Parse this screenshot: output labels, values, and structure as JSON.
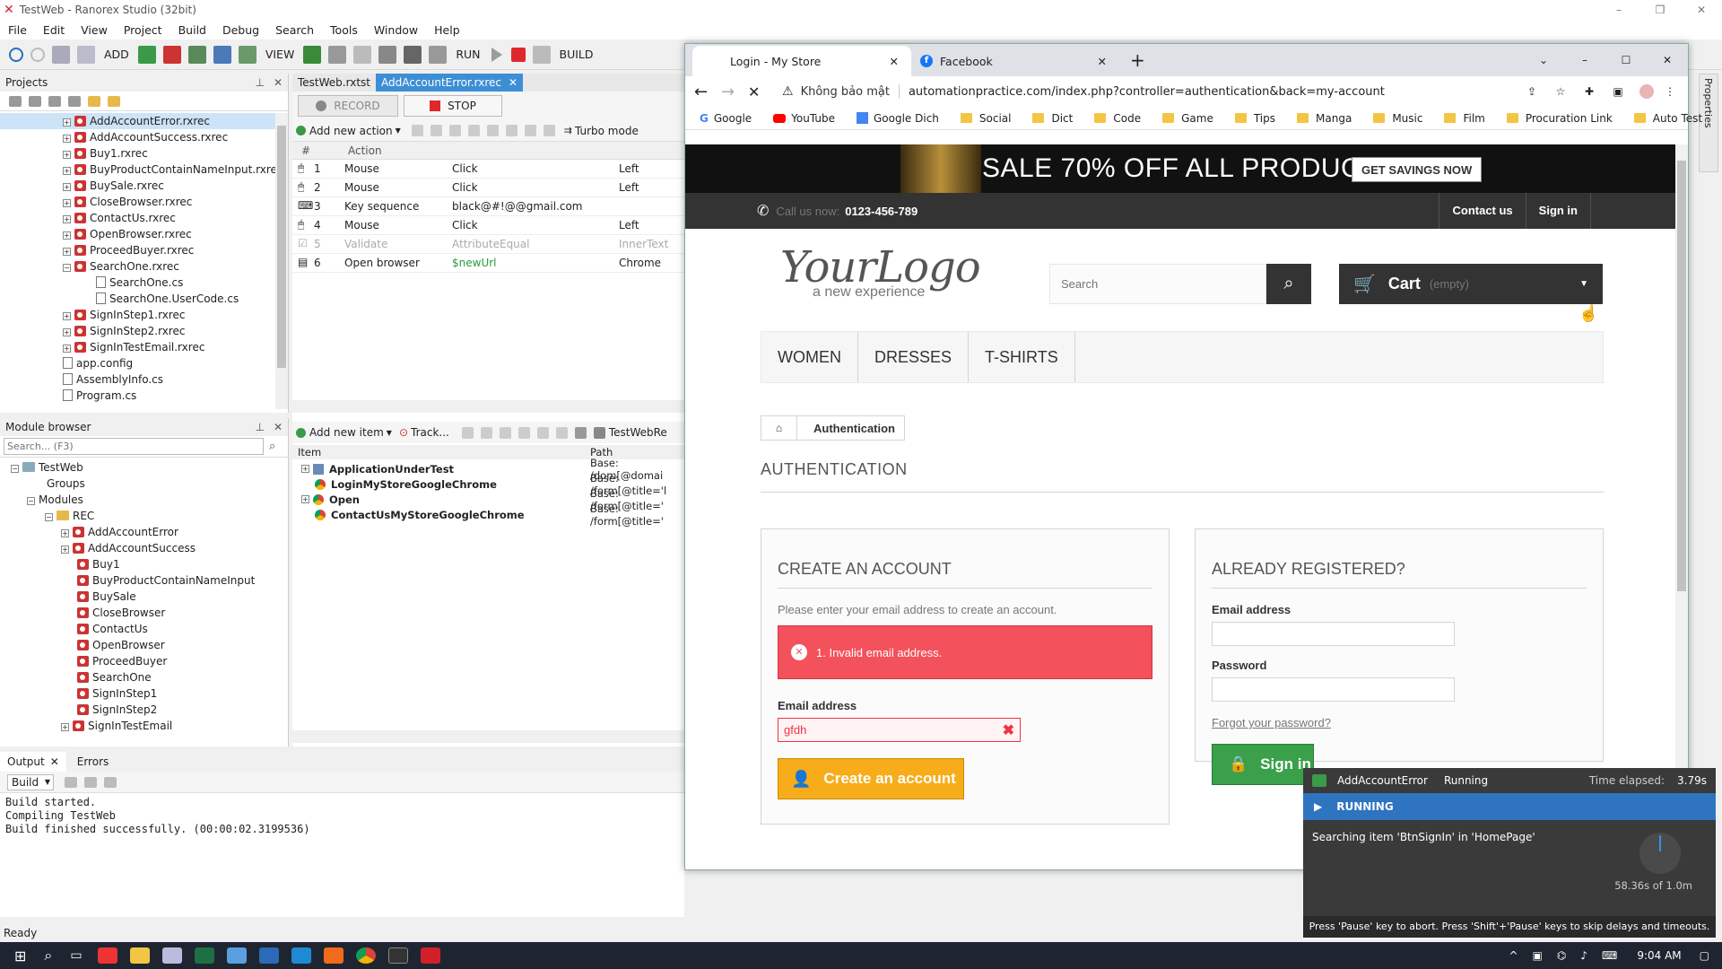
{
  "app": {
    "title": "TestWeb - Ranorex Studio (32bit)",
    "menu": [
      "File",
      "Edit",
      "View",
      "Project",
      "Build",
      "Debug",
      "Search",
      "Tools",
      "Window",
      "Help"
    ],
    "toolbar": {
      "add": "ADD",
      "view": "VIEW",
      "run": "RUN",
      "build": "BUILD"
    }
  },
  "projects": {
    "title": "Projects",
    "items": [
      {
        "label": "AddAccountError.rxrec",
        "selected": true
      },
      {
        "label": "AddAccountSuccess.rxrec"
      },
      {
        "label": "Buy1.rxrec"
      },
      {
        "label": "BuyProductContainNameInput.rxrec"
      },
      {
        "label": "BuySale.rxrec"
      },
      {
        "label": "CloseBrowser.rxrec"
      },
      {
        "label": "ContactUs.rxrec"
      },
      {
        "label": "OpenBrowser.rxrec"
      },
      {
        "label": "ProceedBuyer.rxrec"
      },
      {
        "label": "SearchOne.rxrec",
        "expanded": true
      },
      {
        "label": "SearchOne.cs",
        "child": true
      },
      {
        "label": "SearchOne.UserCode.cs",
        "child": true
      },
      {
        "label": "SignInStep1.rxrec"
      },
      {
        "label": "SignInStep2.rxrec"
      },
      {
        "label": "SignInTestEmail.rxrec"
      },
      {
        "label": "app.config",
        "plain": true
      },
      {
        "label": "AssemblyInfo.cs",
        "plain": true
      },
      {
        "label": "Program.cs",
        "plain": true
      }
    ]
  },
  "module_browser": {
    "title": "Module browser",
    "search_placeholder": "Search... (F3)",
    "root": "TestWeb",
    "groups": "Groups",
    "modules": "Modules",
    "folder": "REC",
    "items": [
      "AddAccountError",
      "AddAccountSuccess",
      "Buy1",
      "BuyProductContainNameInput",
      "BuySale",
      "CloseBrowser",
      "ContactUs",
      "OpenBrowser",
      "ProceedBuyer",
      "SearchOne",
      "SignInStep1",
      "SignInStep2",
      "SignInTestEmail"
    ]
  },
  "editor": {
    "tabs": [
      {
        "label": "TestWeb.rxtst"
      },
      {
        "label": "AddAccountError.rxrec",
        "active": true
      }
    ],
    "record": "RECORD",
    "stop": "STOP",
    "add_action": "Add new action",
    "turbo": "Turbo mode",
    "headers": [
      "#",
      "Action"
    ],
    "rows": [
      {
        "n": "1",
        "type": "Mouse",
        "action": "Click",
        "extra": "Left"
      },
      {
        "n": "2",
        "type": "Mouse",
        "action": "Click",
        "extra": "Left"
      },
      {
        "n": "3",
        "type": "Key sequence",
        "action": "black@#!@@gmail.com",
        "extra": ""
      },
      {
        "n": "4",
        "type": "Mouse",
        "action": "Click",
        "extra": "Left"
      },
      {
        "n": "5",
        "type": "Validate",
        "action": "AttributeEqual",
        "extra": "InnerText",
        "disabled": true
      },
      {
        "n": "6",
        "type": "Open browser",
        "action": "$newUrl",
        "extra": "Chrome",
        "var": true
      }
    ]
  },
  "repository": {
    "add_item": "Add new item",
    "track": "Track...",
    "repo_name": "TestWebRe",
    "headers": [
      "Item",
      "Path"
    ],
    "rows": [
      {
        "item": "ApplicationUnderTest",
        "path": "Base: /dom[@domai"
      },
      {
        "item": "LoginMyStoreGoogleChrome",
        "path": "Base: /form[@title='l"
      },
      {
        "item": "Open",
        "path": "Base: /form[@title='"
      },
      {
        "item": "ContactUsMyStoreGoogleChrome",
        "path": "Base: /form[@title='"
      }
    ]
  },
  "output": {
    "tabs": [
      "Output",
      "Errors"
    ],
    "select": "Build",
    "lines": [
      "Build started.",
      "Compiling TestWeb",
      "Build finished successfully. (00:00:02.3199536)"
    ]
  },
  "status": "Ready",
  "browser": {
    "tabs": [
      {
        "label": "Login - My Store",
        "active": true
      },
      {
        "label": "Facebook"
      }
    ],
    "security": "Không bảo mật",
    "url": "automationpractice.com/index.php?controller=authentication&back=my-account",
    "bookmarks": [
      "Google",
      "YouTube",
      "Google Dich",
      "Social",
      "Dict",
      "Code",
      "Game",
      "Tips",
      "Manga",
      "Music",
      "Film",
      "Procuration Link",
      "Auto Test"
    ]
  },
  "site": {
    "banner": "SALE 70% OFF ALL PRODUCTS",
    "banner_btn": "GET SAVINGS NOW",
    "call_label": "Call us now:",
    "phone": "0123-456-789",
    "contact": "Contact us",
    "signin": "Sign in",
    "logo": "YourLogo",
    "logo_sub": "a new experience",
    "search_placeholder": "Search",
    "cart": "Cart",
    "cart_state": "(empty)",
    "nav": [
      "WOMEN",
      "DRESSES",
      "T-SHIRTS"
    ],
    "breadcrumb": "Authentication",
    "heading": "AUTHENTICATION",
    "create": {
      "title": "CREATE AN ACCOUNT",
      "desc": "Please enter your email address to create an account.",
      "error": "1. Invalid email address.",
      "email_label": "Email address",
      "email_value": "gfdh",
      "button": "Create an account"
    },
    "registered": {
      "title": "ALREADY REGISTERED?",
      "email_label": "Email address",
      "password_label": "Password",
      "forgot": "Forgot your password?",
      "button": "Sign in"
    }
  },
  "runner": {
    "module": "AddAccountError",
    "state": "Running",
    "elapsed_label": "Time elapsed:",
    "elapsed": "3.79s",
    "banner": "RUNNING",
    "message": "Searching item 'BtnSignIn' in 'HomePage'",
    "progress_text": "58.36s of 1.0m",
    "footer": "Press 'Pause' key to abort. Press 'Shift'+'Pause' keys to skip delays and timeouts."
  },
  "taskbar": {
    "time": "9:04 AM"
  },
  "side_panel": "Properties"
}
